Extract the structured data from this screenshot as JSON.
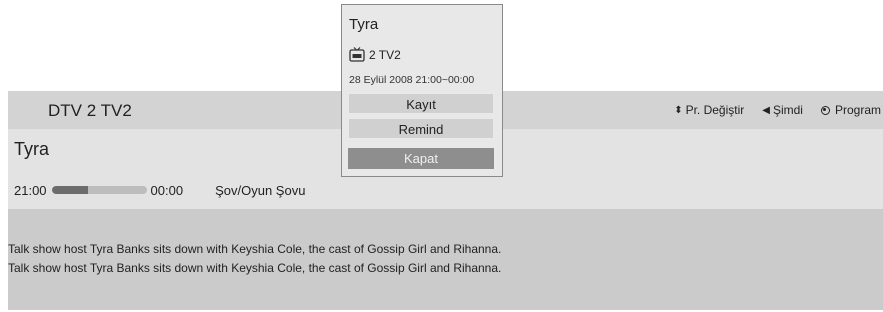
{
  "header": {
    "channel": "DTV 2  TV2",
    "controls": {
      "change_channel": "Pr. Değiştir",
      "now": "Şimdi",
      "program": "Program"
    }
  },
  "program": {
    "title": "Tyra",
    "start_time": "21:00",
    "end_time": "00:00",
    "progress": 0.38,
    "genre": "Şov/Oyun Şovu",
    "description": [
      "Talk show host Tyra Banks sits down with Keyshia Cole, the cast of Gossip Girl and Rihanna.",
      "Talk show host Tyra Banks sits down with Keyshia Cole, the cast of Gossip Girl and Rihanna."
    ]
  },
  "popup": {
    "title": "Tyra",
    "channel": "2 TV2",
    "channel_icon": "tv-icon",
    "datetime": "28 Eylül 2008 21:00~00:00",
    "buttons": {
      "record": "Kayıt",
      "remind": "Remind",
      "close": "Kapat"
    }
  },
  "colors": {
    "header_bg": "#d3d3d3",
    "info_bg": "#e3e3e3",
    "description_bg": "#cbcbcb",
    "popup_bg": "#e8e8e8",
    "close_button_bg": "#8e8e8e"
  }
}
